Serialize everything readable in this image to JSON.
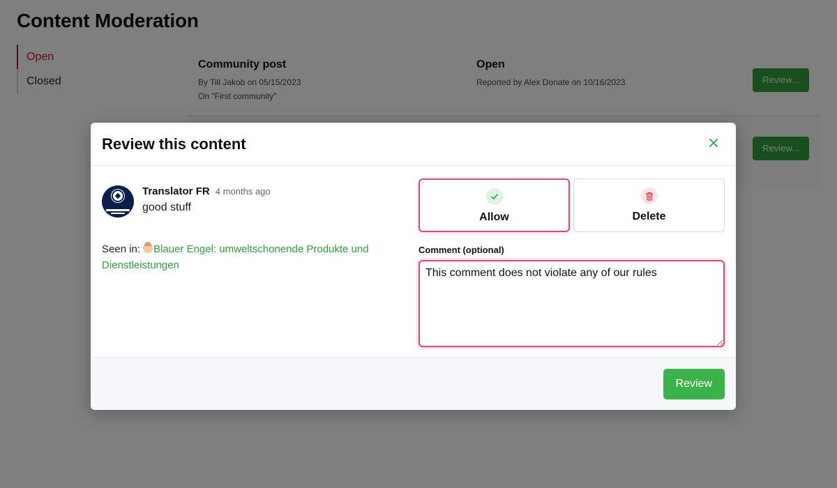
{
  "page": {
    "title": "Content Moderation",
    "nav": [
      {
        "label": "Open",
        "active": true
      },
      {
        "label": "Closed",
        "active": false
      }
    ],
    "rows": [
      {
        "title": "Community post",
        "author_line": "By Till Jakob on 05/15/2023",
        "context_line": "On \"First community\"",
        "status": "Open",
        "reported_line": "Reported by Alex Donate on 10/16/2023",
        "button": "Review..."
      },
      {
        "button": "Review..."
      }
    ]
  },
  "modal": {
    "title": "Review this content",
    "close_icon": "close-icon",
    "comment": {
      "author": "Translator FR",
      "time": "4 months ago",
      "text": "good stuff"
    },
    "seen_in_label": "Seen in:",
    "seen_in_link": "Blauer Engel: umweltschonende Produkte und Dienstleistungen",
    "choices": {
      "allow": {
        "label": "Allow",
        "icon": "check-icon",
        "selected": true
      },
      "delete": {
        "label": "Delete",
        "icon": "trash-icon",
        "selected": false
      }
    },
    "comment_field": {
      "label": "Comment (optional)",
      "value": "This comment does not violate any of our rules"
    },
    "submit": "Review"
  },
  "colors": {
    "accent_red": "#c8102e",
    "accent_pink": "#e0457a",
    "green": "#3cb34a"
  }
}
